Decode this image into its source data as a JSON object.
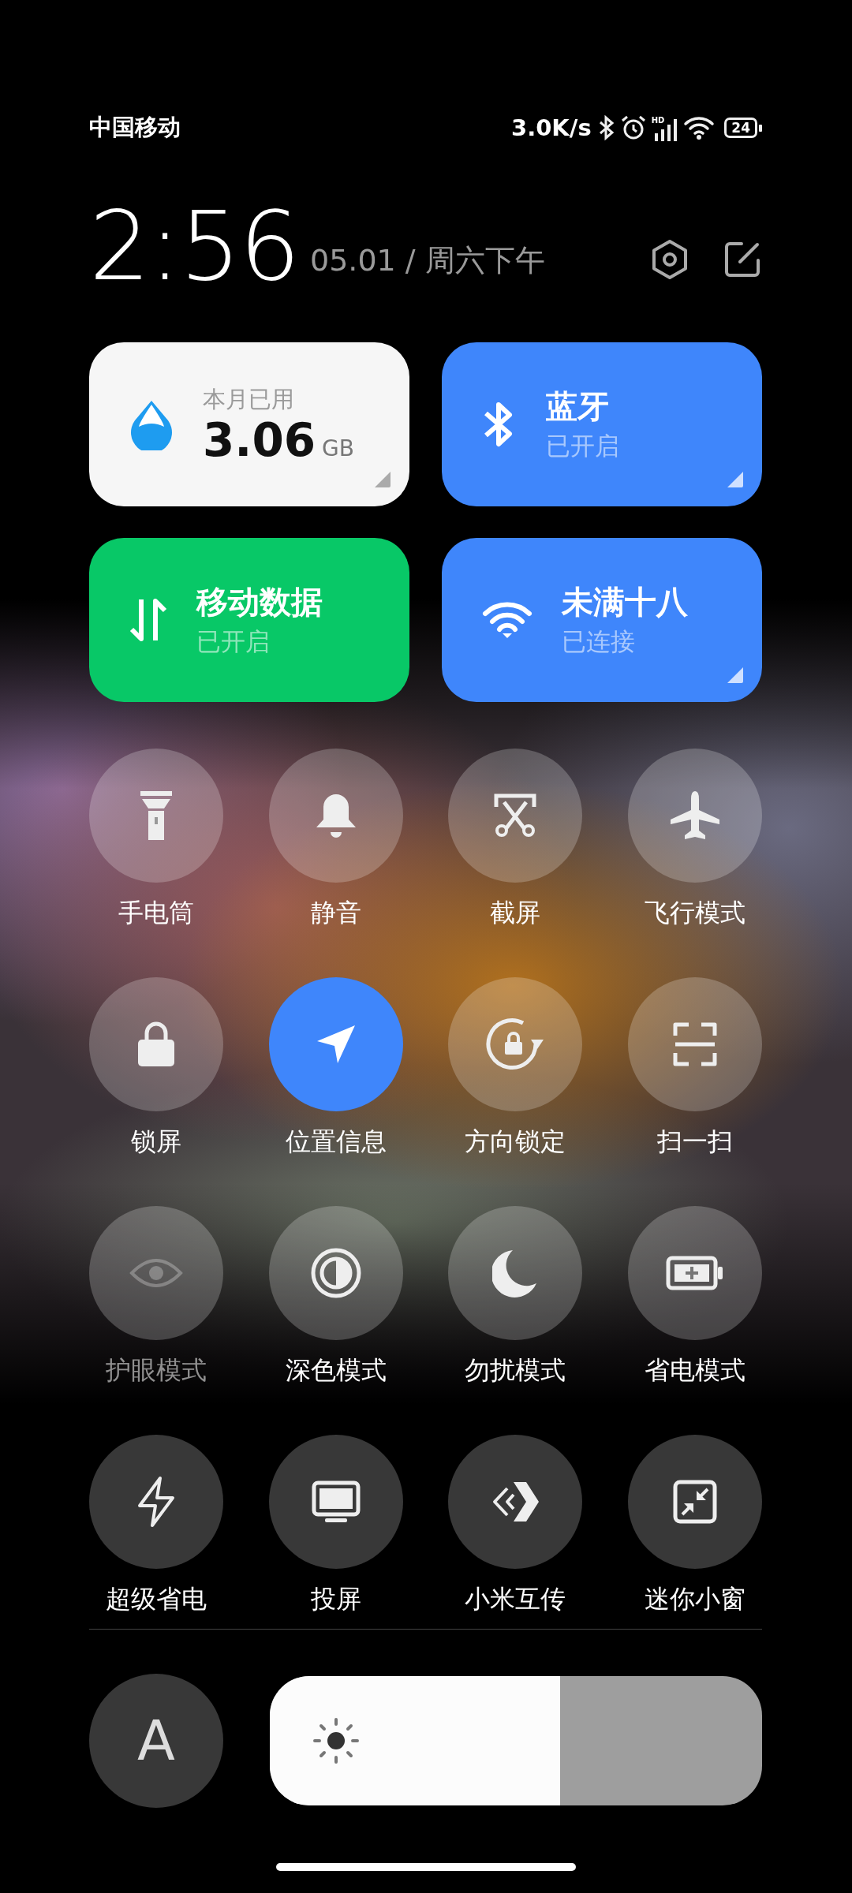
{
  "status_bar": {
    "carrier": "中国移动",
    "speed": "3.0K/s",
    "signal_badge": "HD",
    "battery": "24"
  },
  "header": {
    "time": "2:56",
    "date": "05.01 / 周六下午"
  },
  "cards": [
    {
      "kind": "usage",
      "label": "本月已用",
      "value": "3.06",
      "unit": "GB",
      "color": "#f6f6f6",
      "expandable": true
    },
    {
      "kind": "bluetooth",
      "title": "蓝牙",
      "status": "已开启",
      "color": "#3f86fb",
      "expandable": true
    },
    {
      "kind": "mobile_data",
      "title": "移动数据",
      "status": "已开启",
      "color": "#08c867",
      "expandable": false
    },
    {
      "kind": "wifi",
      "title": "未满十八",
      "status": "已连接",
      "color": "#3f86fb",
      "expandable": true
    }
  ],
  "toggles": [
    {
      "kind": "flashlight",
      "label": "手电筒",
      "on": false,
      "disabled": false
    },
    {
      "kind": "silent",
      "label": "静音",
      "on": false,
      "disabled": false
    },
    {
      "kind": "screenshot",
      "label": "截屏",
      "on": false,
      "disabled": false
    },
    {
      "kind": "airplane",
      "label": "飞行模式",
      "on": false,
      "disabled": false
    },
    {
      "kind": "lock",
      "label": "锁屏",
      "on": false,
      "disabled": false
    },
    {
      "kind": "location",
      "label": "位置信息",
      "on": true,
      "disabled": false
    },
    {
      "kind": "rotation",
      "label": "方向锁定",
      "on": false,
      "disabled": false
    },
    {
      "kind": "scan",
      "label": "扫一扫",
      "on": false,
      "disabled": false
    },
    {
      "kind": "eye",
      "label": "护眼模式",
      "on": false,
      "disabled": true
    },
    {
      "kind": "dark",
      "label": "深色模式",
      "on": false,
      "disabled": false
    },
    {
      "kind": "dnd",
      "label": "勿扰模式",
      "on": false,
      "disabled": false
    },
    {
      "kind": "battery",
      "label": "省电模式",
      "on": false,
      "disabled": false
    },
    {
      "kind": "bolt",
      "label": "超级省电",
      "on": false,
      "disabled": false
    },
    {
      "kind": "cast",
      "label": "投屏",
      "on": false,
      "disabled": false
    },
    {
      "kind": "share",
      "label": "小米互传",
      "on": false,
      "disabled": false
    },
    {
      "kind": "window",
      "label": "迷你小窗",
      "on": false,
      "disabled": false
    }
  ],
  "brightness": {
    "auto_label": "A",
    "level": 0.59
  }
}
